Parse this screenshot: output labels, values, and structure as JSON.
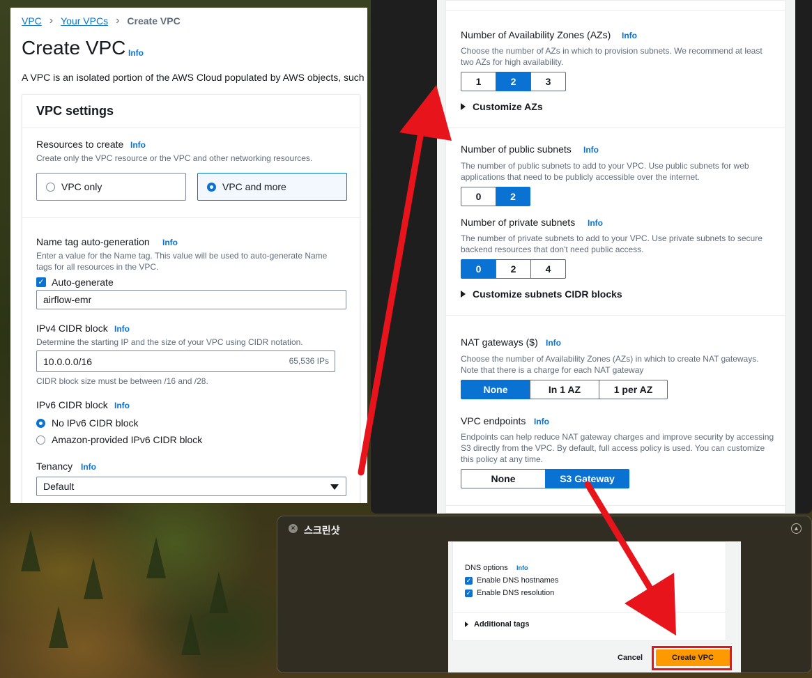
{
  "left": {
    "breadcrumb": [
      "VPC",
      "Your VPCs",
      "Create VPC"
    ],
    "title": "Create VPC",
    "info": "Info",
    "description": "A VPC is an isolated portion of the AWS Cloud populated by AWS objects, such",
    "card_title": "VPC settings",
    "resources": {
      "label": "Resources to create",
      "desc": "Create only the VPC resource or the VPC and other networking resources.",
      "options": [
        "VPC only",
        "VPC and more"
      ],
      "selected": "VPC and more"
    },
    "name_tag": {
      "label": "Name tag auto-generation",
      "desc": "Enter a value for the Name tag. This value will be used to auto-generate Name tags for all resources in the VPC.",
      "checkbox": "Auto-generate",
      "value": "airflow-emr"
    },
    "ipv4": {
      "label": "IPv4 CIDR block",
      "desc": "Determine the starting IP and the size of your VPC using CIDR notation.",
      "value": "10.0.0.0/16",
      "suffix": "65,536 IPs",
      "hint": "CIDR block size must be between /16 and /28."
    },
    "ipv6": {
      "label": "IPv6 CIDR block",
      "options": [
        "No IPv6 CIDR block",
        "Amazon-provided IPv6 CIDR block"
      ],
      "selected": "No IPv6 CIDR block"
    },
    "tenancy": {
      "label": "Tenancy",
      "value": "Default"
    }
  },
  "right": {
    "az": {
      "label": "Number of Availability Zones (AZs)",
      "desc": "Choose the number of AZs in which to provision subnets. We recommend at least two AZs for high availability.",
      "options": [
        "1",
        "2",
        "3"
      ],
      "selected": "2",
      "expander": "Customize AZs"
    },
    "public": {
      "label": "Number of public subnets",
      "desc": "The number of public subnets to add to your VPC. Use public subnets for web applications that need to be publicly accessible over the internet.",
      "options": [
        "0",
        "2"
      ],
      "selected": "2"
    },
    "private": {
      "label": "Number of private subnets",
      "desc": "The number of private subnets to add to your VPC. Use private subnets to secure backend resources that don't need public access.",
      "options": [
        "0",
        "2",
        "4"
      ],
      "selected": "0",
      "expander": "Customize subnets CIDR blocks"
    },
    "nat": {
      "label": "NAT gateways ($)",
      "desc": "Choose the number of Availability Zones (AZs) in which to create NAT gateways. Note that there is a charge for each NAT gateway",
      "options": [
        "None",
        "In 1 AZ",
        "1 per AZ"
      ],
      "selected": "None"
    },
    "endpoints": {
      "label": "VPC endpoints",
      "desc": "Endpoints can help reduce NAT gateway charges and improve security by accessing S3 directly from the VPC. By default, full access policy is used. You can customize this policy at any time.",
      "options": [
        "None",
        "S3 Gateway"
      ],
      "selected": "S3 Gateway"
    }
  },
  "shot": {
    "title": "스크린샷",
    "dns_label": "DNS options",
    "checks": [
      "Enable DNS hostnames",
      "Enable DNS resolution"
    ],
    "additional_tags": "Additional tags",
    "cancel": "Cancel",
    "create": "Create VPC"
  },
  "colors": {
    "accent": "#0972d3",
    "primary_button": "#ff9900",
    "annotation": "#e8141c"
  }
}
